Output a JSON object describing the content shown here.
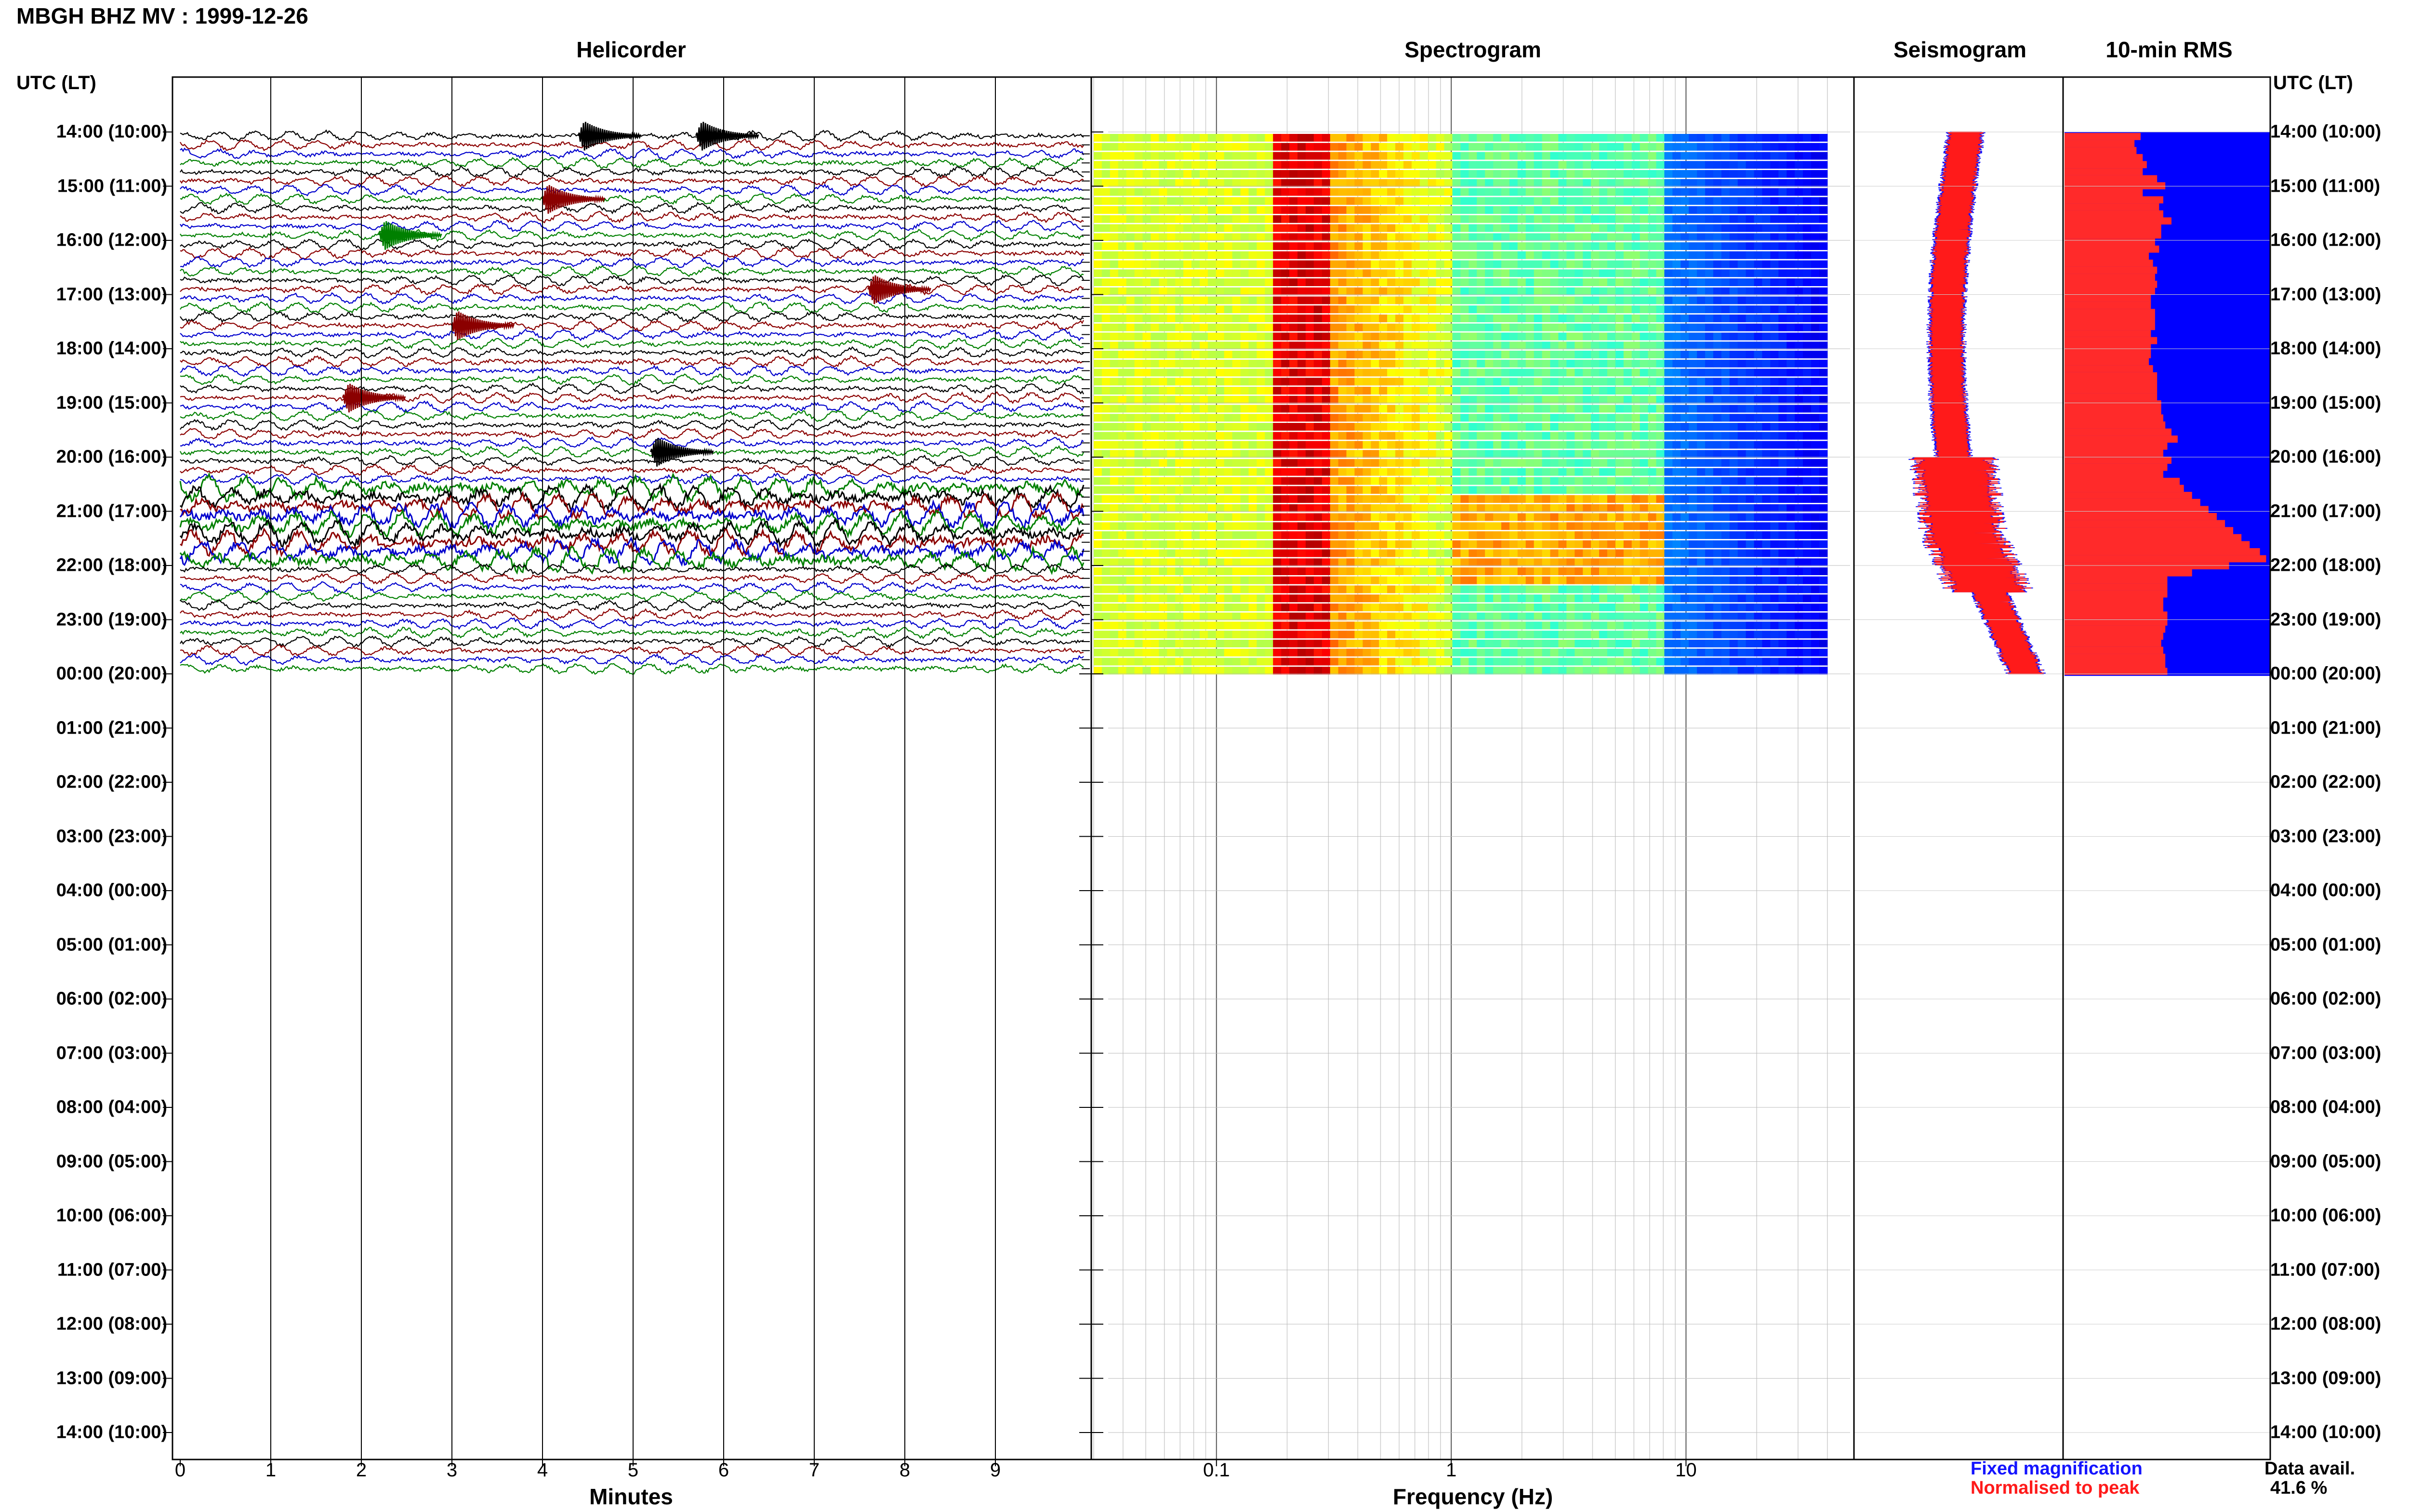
{
  "header": {
    "title": "MBGH BHZ MV : 1999-12-26"
  },
  "panels": {
    "helicorder": "Helicorder",
    "spectrogram": "Spectrogram",
    "seismogram": "Seismogram",
    "rms": "10-min RMS"
  },
  "time_axis": {
    "heading_left": "UTC (LT)",
    "heading_right": "UTC (LT)",
    "labels": [
      "14:00 (10:00)",
      "15:00 (11:00)",
      "16:00 (12:00)",
      "17:00 (13:00)",
      "18:00 (14:00)",
      "19:00 (15:00)",
      "20:00 (16:00)",
      "21:00 (17:00)",
      "22:00 (18:00)",
      "23:00 (19:00)",
      "00:00 (20:00)",
      "01:00 (21:00)",
      "02:00 (22:00)",
      "03:00 (23:00)",
      "04:00 (00:00)",
      "05:00 (01:00)",
      "06:00 (02:00)",
      "07:00 (03:00)",
      "08:00 (04:00)",
      "09:00 (05:00)",
      "10:00 (06:00)",
      "11:00 (07:00)",
      "12:00 (08:00)",
      "13:00 (09:00)",
      "14:00 (10:00)"
    ]
  },
  "helicorder_axis": {
    "xlabel": "Minutes",
    "ticks": [
      "0",
      "1",
      "2",
      "3",
      "4",
      "5",
      "6",
      "7",
      "8",
      "9"
    ]
  },
  "spectrogram_axis": {
    "xlabel": "Frequency (Hz)",
    "ticks": [
      "0.1",
      "1",
      "10"
    ]
  },
  "legend": {
    "fixed": "Fixed magnification",
    "normalised": "Normalised to peak",
    "fixed_color": "#1414ff",
    "normalised_color": "#ff1a1a"
  },
  "availability": {
    "label": "Data avail.",
    "value": "41.6 %"
  },
  "chart_data": [
    {
      "type": "line",
      "panel": "Helicorder",
      "xlabel": "Minutes",
      "x_range": [
        0,
        10
      ],
      "ylabel": "UTC (LT)",
      "data_hours": 10,
      "traces_per_hour": 6,
      "trace_colors": [
        "#000000",
        "#8b0000",
        "#0000cd",
        "#008000"
      ],
      "high_amplitude_window": [
        "20:30",
        "22:00"
      ],
      "events": [
        {
          "time": "14:00",
          "minute": 4.5,
          "color": "#000000"
        },
        {
          "time": "14:00",
          "minute": 5.8,
          "color": "#000000"
        },
        {
          "time": "15:10",
          "minute": 4.1,
          "color": "#8b0000"
        },
        {
          "time": "15:50",
          "minute": 2.3,
          "color": "#008000"
        },
        {
          "time": "16:50",
          "minute": 7.7,
          "color": "#8b0000"
        },
        {
          "time": "17:30",
          "minute": 3.1,
          "color": "#8b0000"
        },
        {
          "time": "18:50",
          "minute": 1.9,
          "color": "#8b0000"
        },
        {
          "time": "19:50",
          "minute": 5.3,
          "color": "#000000"
        }
      ]
    },
    {
      "type": "heatmap",
      "panel": "Spectrogram",
      "xlabel": "Frequency (Hz)",
      "x_scale": "log",
      "x_range": [
        0.03,
        50
      ],
      "data_end_frequency": 40,
      "peak_frequency_band": [
        0.17,
        0.3
      ],
      "time_range": [
        "14:00",
        "00:00"
      ]
    },
    {
      "type": "line",
      "panel": "Seismogram",
      "series": [
        {
          "name": "Fixed magnification",
          "color": "#1414ff"
        },
        {
          "name": "Normalised to peak",
          "color": "#ff1a1a"
        }
      ],
      "time_range": [
        "14:00",
        "00:00"
      ]
    },
    {
      "type": "bar",
      "panel": "10-min RMS",
      "bin_minutes": 10,
      "series": [
        {
          "color": "#ff2a2a",
          "values": [
            0.37,
            0.34,
            0.35,
            0.38,
            0.4,
            0.38,
            0.45,
            0.49,
            0.38,
            0.48,
            0.46,
            0.48,
            0.52,
            0.47,
            0.47,
            0.44,
            0.46,
            0.41,
            0.43,
            0.45,
            0.44,
            0.45,
            0.44,
            0.42,
            0.42,
            0.44,
            0.44,
            0.44,
            0.42,
            0.45,
            0.42,
            0.42,
            0.41,
            0.43,
            0.45,
            0.45,
            0.45,
            0.45,
            0.47,
            0.47,
            0.48,
            0.49,
            0.52,
            0.55,
            0.5,
            0.48,
            0.52,
            0.5,
            0.48,
            0.56,
            0.58,
            0.62,
            0.66,
            0.7,
            0.74,
            0.78,
            0.82,
            0.86,
            0.9,
            0.95,
            0.98,
            0.8,
            0.62,
            0.5,
            0.5,
            0.5,
            0.48,
            0.48,
            0.5,
            0.5,
            0.49,
            0.48,
            0.47,
            0.48,
            0.49,
            0.49,
            0.5
          ]
        },
        {
          "color": "#0000ff",
          "values": [
            1,
            1,
            1,
            1,
            1,
            1,
            1,
            1,
            1,
            1,
            1,
            1,
            1,
            1,
            1,
            1,
            1,
            1,
            1,
            1,
            1,
            1,
            1,
            1,
            1,
            1,
            1,
            1,
            1,
            1,
            1,
            1,
            1,
            1,
            1,
            1,
            1,
            1,
            1,
            1,
            1,
            1,
            1,
            1,
            1,
            1,
            1,
            1,
            1,
            1,
            1,
            1,
            1,
            1,
            1,
            1,
            1,
            1,
            1,
            1,
            1,
            1,
            1,
            1,
            1,
            1,
            1,
            1,
            1,
            1,
            1,
            1,
            1,
            1,
            1,
            1,
            1
          ]
        }
      ]
    }
  ]
}
